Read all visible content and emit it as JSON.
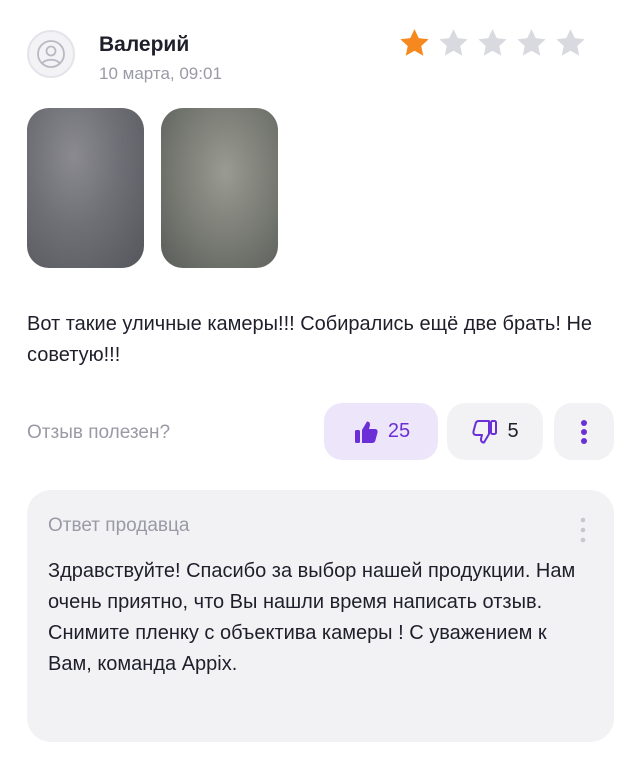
{
  "review": {
    "author": "Валерий",
    "date": "10 марта, 09:01",
    "rating": 1,
    "rating_max": 5,
    "text": "Вот такие уличные камеры!!! Собирались ещё две брать! Не советую!!!",
    "photos_count": 2
  },
  "helpful": {
    "label": "Отзыв полезен?",
    "likes": "25",
    "dislikes": "5"
  },
  "seller_reply": {
    "title": "Ответ продавца",
    "text": "Здравствуйте! Спасибо за выбор нашей продукции. Нам очень приятно, что Вы нашли время написать отзыв. Снимите пленку с объектива камеры ! С уважением к Вам, команда Appix."
  },
  "colors": {
    "star_active": "#f5891f",
    "star_inactive": "#d9d9e0",
    "accent": "#6a2fd6",
    "like_bg": "#ede6fb"
  },
  "icons": [
    "user-icon",
    "star-icon",
    "thumbs-up-icon",
    "thumbs-down-icon",
    "more-vertical-icon"
  ]
}
